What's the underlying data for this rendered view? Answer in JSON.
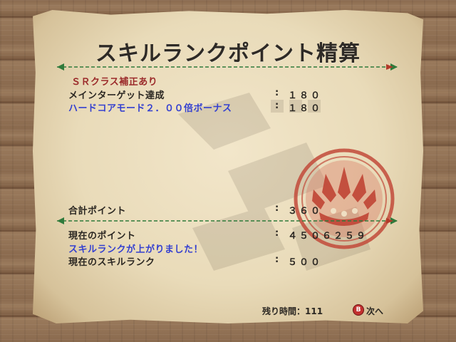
{
  "title": "スキルランクポイント精算",
  "rows": [
    {
      "label": "ＳＲクラス補正あり",
      "colon": "",
      "value": ""
    },
    {
      "label": "メインターゲット達成",
      "colon": ":",
      "value": "１８０"
    },
    {
      "label": "ハードコアモード２．００倍ボーナス",
      "colon": ":",
      "value": "１８０"
    }
  ],
  "total": {
    "label": "合計ポイント",
    "colon": ":",
    "value": "３６０"
  },
  "current_points": {
    "label": "現在のポイント",
    "colon": ":",
    "value": "４５０６２５９"
  },
  "rank_up_message": "スキルランクが上がりました！",
  "current_rank": {
    "label": "現在のスキルランク",
    "colon": ":",
    "value": "５００"
  },
  "footer": {
    "remaining_label": "残り時間：111",
    "button_glyph": "B",
    "next_label": "次へ"
  },
  "colors": {
    "accent_green": "#2f7a3b",
    "seal_red": "#c24a3a",
    "highlight_blue": "#3440d0",
    "highlight_red": "#9b2a2a"
  }
}
